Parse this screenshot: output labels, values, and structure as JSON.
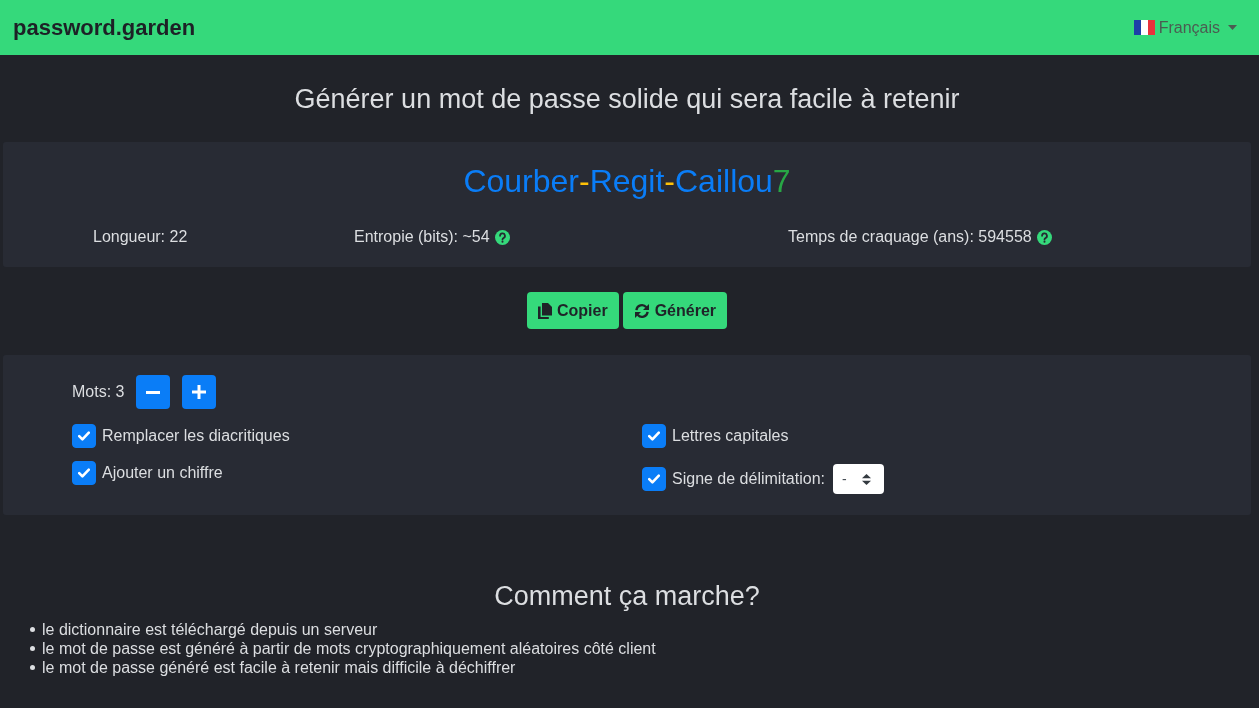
{
  "navbar": {
    "brand": "password.garden",
    "language": "Français"
  },
  "heading": "Générer un mot de passe solide qui sera facile à retenir",
  "password": {
    "parts": [
      {
        "text": "Courber",
        "color": "#0a7df7"
      },
      {
        "text": "-",
        "color": "#ffc107"
      },
      {
        "text": "Regit",
        "color": "#0a7df7"
      },
      {
        "text": "-",
        "color": "#ffc107"
      },
      {
        "text": "Caillou",
        "color": "#0a7df7"
      },
      {
        "text": "7",
        "color": "#28a745"
      }
    ]
  },
  "stats": [
    {
      "text": "Longueur: 22",
      "help": false
    },
    {
      "text": "Entropie (bits): ~54",
      "help": true
    },
    {
      "text": "Temps de craquage (ans): 594558",
      "help": true
    }
  ],
  "actions": [
    {
      "label": "Copier",
      "kind": "copy"
    },
    {
      "label": "Générer",
      "kind": "regenerate"
    }
  ],
  "options": {
    "words": "Mots: 3",
    "columns": [
      {
        "items": [
          {
            "kind": "checkbox",
            "label": "Remplacer les diacritiques",
            "checked": true
          },
          {
            "kind": "checkbox",
            "label": "Ajouter un chiffre",
            "checked": true
          }
        ]
      },
      {
        "items": [
          {
            "kind": "checkbox",
            "label": "Lettres capitales",
            "checked": true
          },
          {
            "kind": "checkbox_select",
            "label": "Signe de délimitation:",
            "checked": true,
            "select_value": "-"
          }
        ]
      }
    ]
  },
  "how_it_works": {
    "title": "Comment ça marche?",
    "items": [
      "le dictionnaire est téléchargé depuis un serveur",
      "le mot de passe est généré à partir de mots cryptographiquement aléatoires côté client",
      "le mot de passe généré est facile à retenir mais difficile à déchiffrer"
    ]
  }
}
